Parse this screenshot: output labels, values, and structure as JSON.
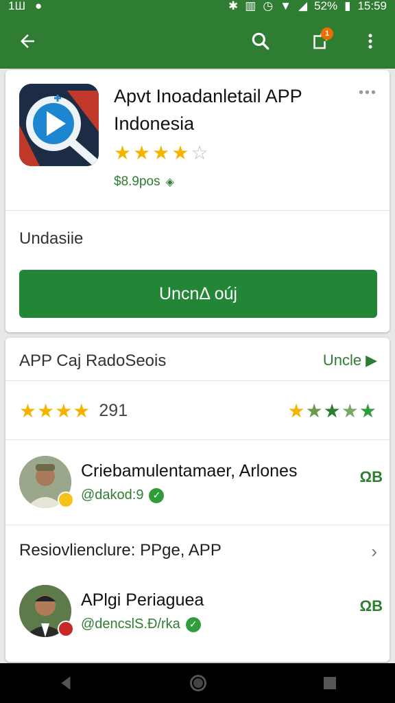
{
  "status_bar": {
    "left_text": "1Ш",
    "battery": "52%",
    "time": "15:59"
  },
  "toolbar": {
    "back_icon": "arrow-left-icon",
    "search_icon": "search-icon",
    "share_icon": "share-icon",
    "share_badge": "1",
    "menu_icon": "more-vert-icon"
  },
  "app": {
    "title": "Apvt Inoadanletail APP Indonesia",
    "rating_stars": 4,
    "max_stars": 5,
    "price": "$8.9pos",
    "status_label": "Undasiie",
    "install_label": "UncnΔ oúj",
    "brand_color": "#238636"
  },
  "reviews_section": {
    "heading": "APP Caj RadoSeois",
    "link_label": "Uncle",
    "rating_count": "291",
    "left_stars": 4.5,
    "right_stars": 5
  },
  "reviews": [
    {
      "name": "Criebamulentamaer, Arlones",
      "handle": "@dakod:9",
      "tag": "ΩB",
      "badge_color": "#f4c21a"
    }
  ],
  "sub_section": {
    "heading": "Resiovlienclure: PPge, APP"
  },
  "reviews2": [
    {
      "name": "APlgi Periaguea",
      "handle": "@dencslS.Ð/rka",
      "tag": "ΩB",
      "badge_color": "#c62828"
    }
  ]
}
